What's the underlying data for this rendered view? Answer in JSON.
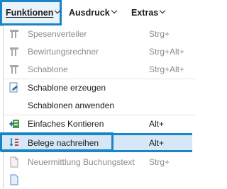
{
  "menubar": {
    "items": [
      {
        "label": "Funktionen"
      },
      {
        "label": "Ausdruck"
      },
      {
        "label": "Extras"
      }
    ]
  },
  "dropdown": {
    "items": [
      {
        "label": "Spesenverteiler",
        "shortcut": "Strg+",
        "icon": "split-icon",
        "enabled": false
      },
      {
        "label": "Bewirtungsrechner",
        "shortcut": "Strg+Alt+",
        "icon": "split-icon",
        "enabled": false
      },
      {
        "label": "Schablone",
        "shortcut": "Strg+Alt+",
        "icon": "split-icon",
        "enabled": false
      },
      {
        "label": "Schablone erzeugen",
        "shortcut": "",
        "icon": "template-create-icon",
        "enabled": true
      },
      {
        "label": "Schablonen anwenden",
        "shortcut": "",
        "icon": "",
        "enabled": true
      },
      {
        "label": "Einfaches Kontieren",
        "shortcut": "Alt+",
        "icon": "simple-booking-icon",
        "enabled": true
      },
      {
        "label": "Belege nachreihen",
        "shortcut": "Alt+",
        "icon": "sort-icon",
        "enabled": true
      },
      {
        "label": "Neuermittlung Buchungstext",
        "shortcut": "Strg+",
        "icon": "document-icon",
        "enabled": false
      }
    ]
  },
  "colors": {
    "highlight_border": "#1a84c7",
    "highlight_fill": "#d6e8f6",
    "disabled_text": "#8c8c8c"
  }
}
